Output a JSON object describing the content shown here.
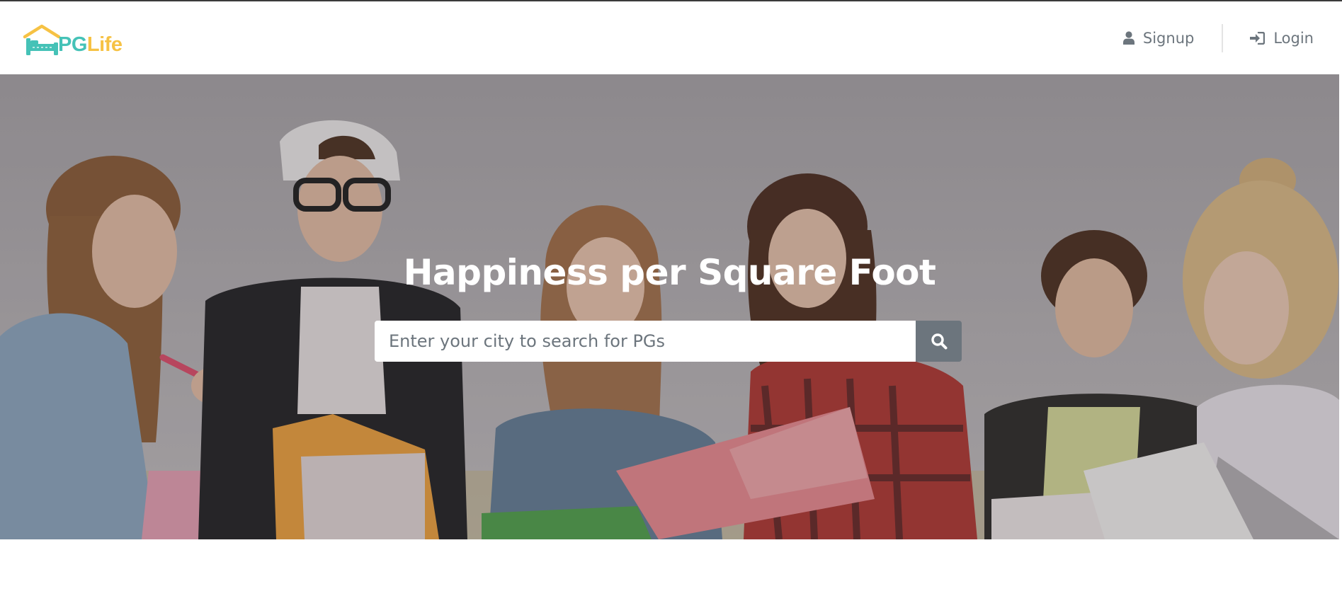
{
  "brand": {
    "name_part1": "PG",
    "name_part2": "Life",
    "icon": "house-bed-logo-icon",
    "colors": {
      "primary": "#45c2b7",
      "accent": "#f6c244"
    }
  },
  "nav": {
    "signup": {
      "label": "Signup",
      "icon": "user-icon"
    },
    "login": {
      "label": "Login",
      "icon": "sign-in-icon"
    }
  },
  "hero": {
    "title": "Happiness per Square Foot",
    "background": "students-studying-photo"
  },
  "search": {
    "placeholder": "Enter your city to search for PGs",
    "value": "",
    "button_icon": "search-icon",
    "button_color": "#6c757d"
  }
}
